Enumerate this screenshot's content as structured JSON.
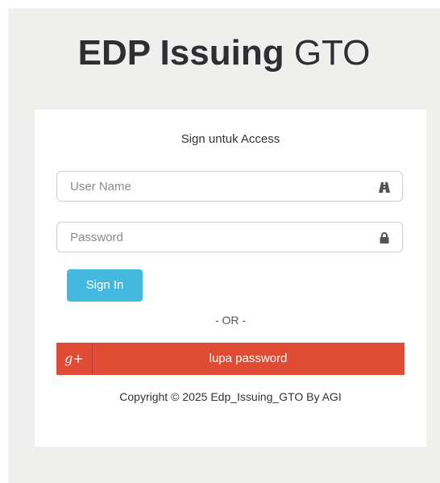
{
  "header": {
    "title_bold": "EDP Issuing",
    "title_light": "GTO"
  },
  "login": {
    "subtitle": "Sign untuk Access",
    "username_placeholder": "User Name",
    "password_placeholder": "Password",
    "signin_label": "Sign In",
    "or_label": "- OR -",
    "forgot_label": "lupa password",
    "forgot_icon_text": "g+"
  },
  "footer": {
    "copyright": "Copyright © 2025 Edp_Issuing_GTO By AGI"
  },
  "icons": {
    "username": "road-icon",
    "password": "lock-icon",
    "forgot": "google-plus-icon"
  },
  "colors": {
    "signin_button": "#44b9e0",
    "forgot_button": "#e04b35",
    "background": "#efefee",
    "card": "#ffffff"
  }
}
